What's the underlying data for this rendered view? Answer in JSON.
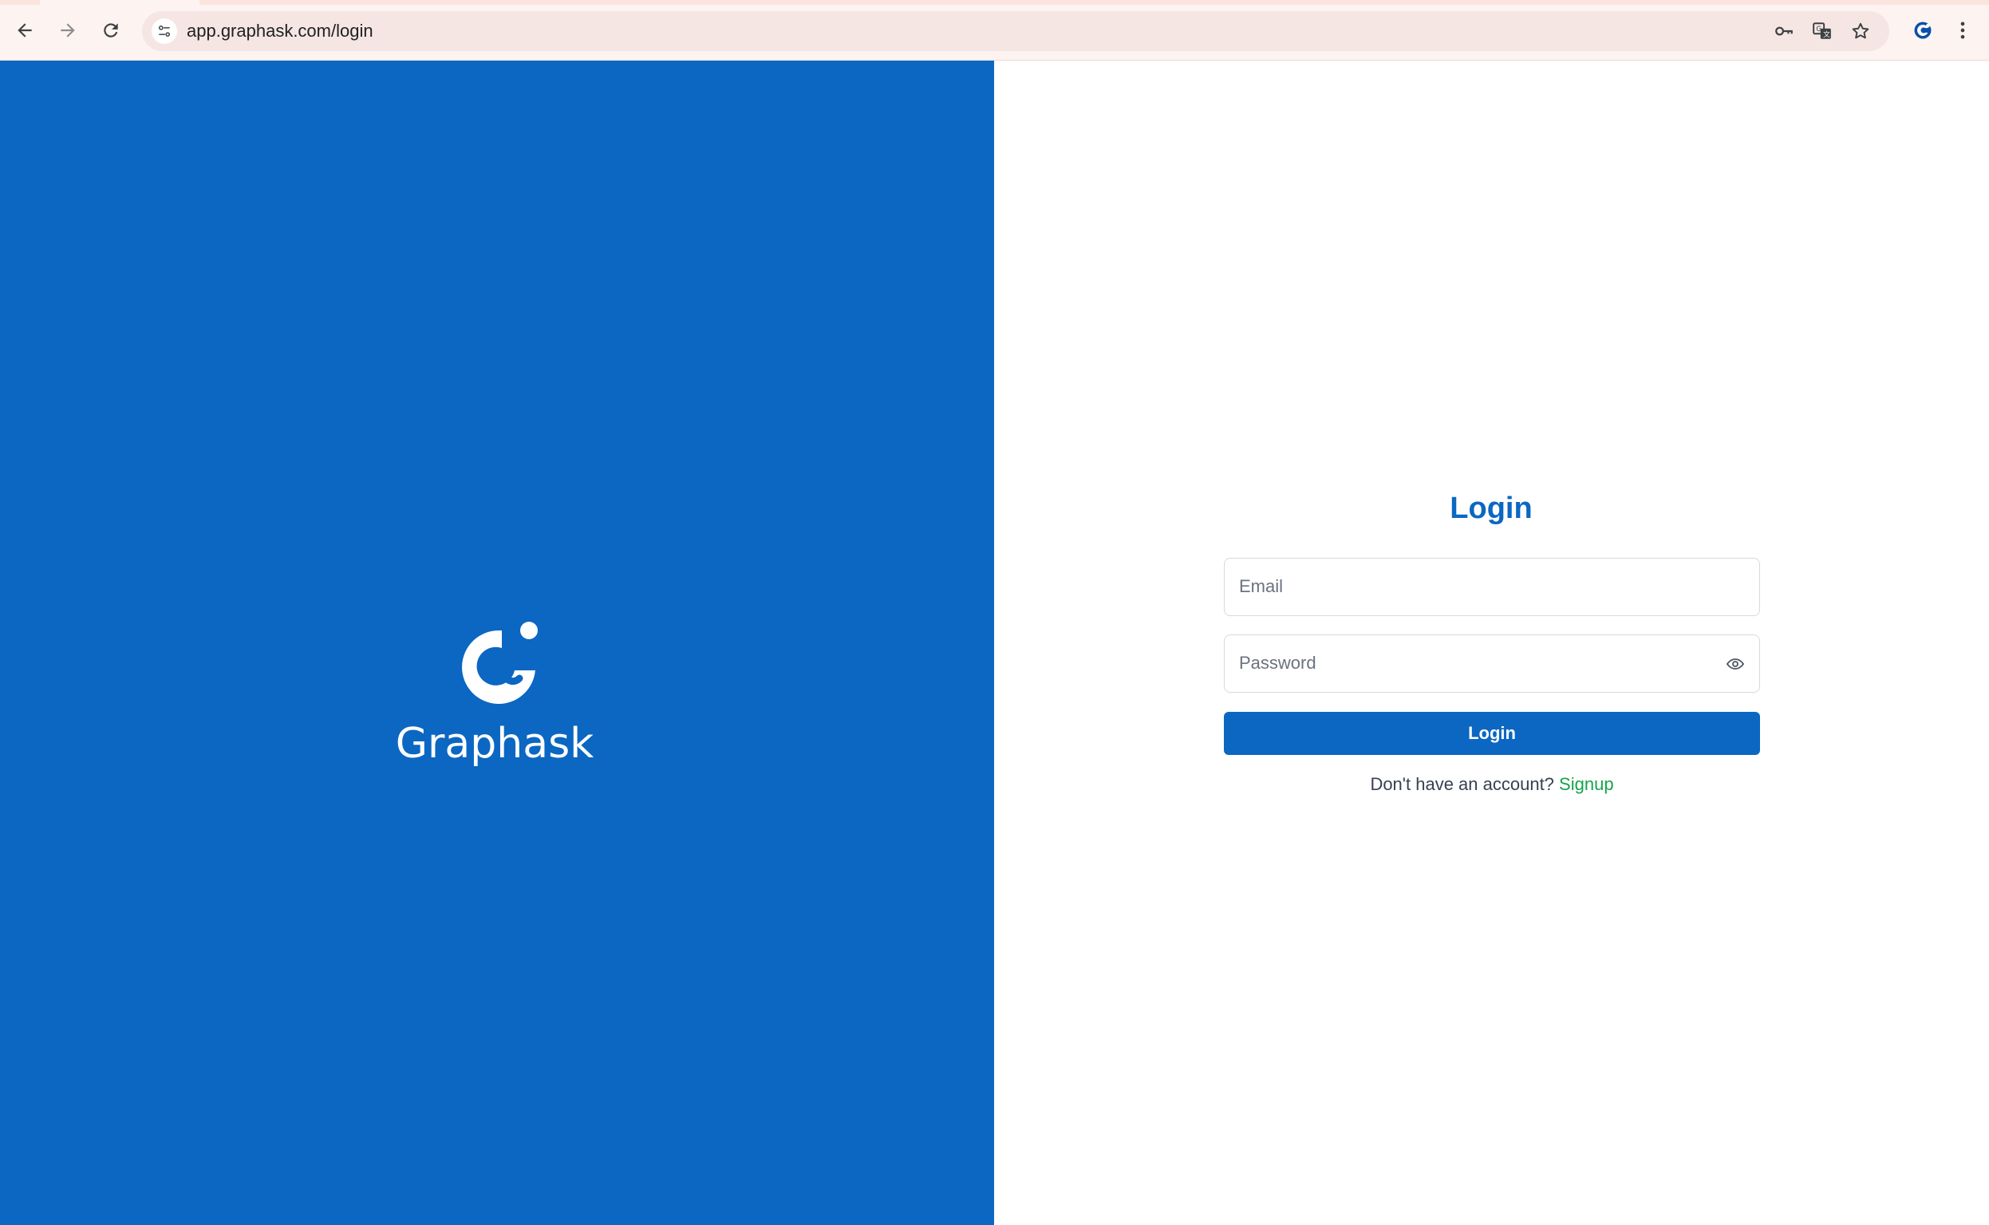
{
  "browser": {
    "url": "app.graphask.com/login",
    "icons": {
      "back": "arrow-left-icon",
      "forward": "arrow-right-icon",
      "reload": "reload-icon",
      "site_info": "tune-icon",
      "password": "key-icon",
      "translate": "translate-icon",
      "bookmark": "star-icon",
      "extension": "extension-icon",
      "menu": "kebab-menu-icon"
    }
  },
  "brand": {
    "name": "Graphask",
    "background_color": "#0b67c2"
  },
  "login": {
    "title": "Login",
    "email_placeholder": "Email",
    "email_value": "",
    "password_placeholder": "Password",
    "password_value": "",
    "submit_label": "Login",
    "signup_prompt": "Don't have an account?",
    "signup_link": "Signup",
    "accent_color": "#0b67c2",
    "link_color": "#16a34a"
  }
}
